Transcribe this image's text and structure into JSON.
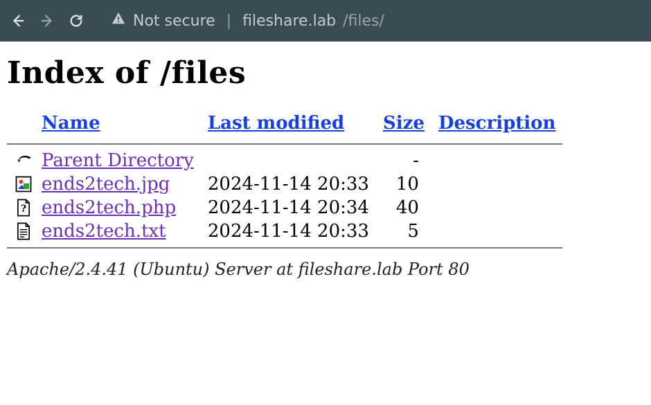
{
  "browser": {
    "security_label": "Not secure",
    "url_host": "fileshare.lab",
    "url_path": "/files/"
  },
  "page": {
    "title": "Index of /files",
    "columns": {
      "name": "Name",
      "last_modified": "Last modified",
      "size": "Size",
      "description": "Description"
    },
    "parent": {
      "label": "Parent Directory",
      "size": "-"
    },
    "files": [
      {
        "name": "ends2tech.jpg",
        "modified": "2024-11-14 20:33",
        "size": "10",
        "type": "image"
      },
      {
        "name": "ends2tech.php",
        "modified": "2024-11-14 20:34",
        "size": "40",
        "type": "unknown"
      },
      {
        "name": "ends2tech.txt",
        "modified": "2024-11-14 20:33",
        "size": "5",
        "type": "text"
      }
    ],
    "server_signature": "Apache/2.4.41 (Ubuntu) Server at fileshare.lab Port 80"
  }
}
